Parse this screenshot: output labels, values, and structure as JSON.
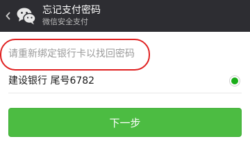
{
  "header": {
    "back_icon": "chevron-left-icon",
    "logo_icon": "wechat-logo-icon",
    "title": "忘记支付密码",
    "subtitle": "微信安全支付",
    "background": "#2d2d32"
  },
  "prompt": {
    "text": "请重新绑定银行卡以找回密码",
    "highlight_color": "#e02020"
  },
  "bank_option": {
    "label": "建设银行 尾号6782",
    "selected": true,
    "radio_color": "#1aad19"
  },
  "next_button": {
    "label": "下一步",
    "color": "#4cbc42"
  }
}
